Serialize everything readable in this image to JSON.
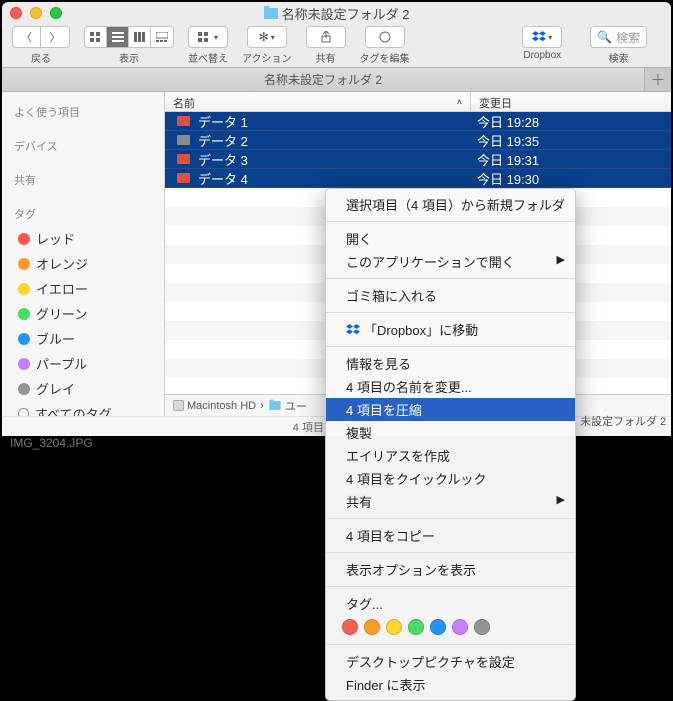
{
  "window": {
    "title": "名称未設定フォルダ 2"
  },
  "toolbar": {
    "back_label": "戻る",
    "view_label": "表示",
    "arrange_label": "並べ替え",
    "action_label": "アクション",
    "share_label": "共有",
    "tags_label": "タグを編集",
    "dropbox_label": "Dropbox",
    "search_label": "検索",
    "search_placeholder": "検索"
  },
  "tabbar": {
    "tab": "名称未設定フォルダ 2",
    "add": "＋"
  },
  "sidebar": {
    "favorites": "よく使う項目",
    "devices": "デバイス",
    "shared": "共有",
    "tags_head": "タグ",
    "tags": [
      {
        "label": "レッド",
        "color": "#ff554a"
      },
      {
        "label": "オレンジ",
        "color": "#ff9a29"
      },
      {
        "label": "イエロー",
        "color": "#ffd42c"
      },
      {
        "label": "グリーン",
        "color": "#4cd964"
      },
      {
        "label": "ブルー",
        "color": "#2094fa"
      },
      {
        "label": "パープル",
        "color": "#c680ff"
      },
      {
        "label": "グレイ",
        "color": "#949494"
      }
    ],
    "all_tags": "すべてのタグ..."
  },
  "columns": {
    "name": "名前",
    "modified": "変更日"
  },
  "rows": [
    {
      "name": "データ 1",
      "date": "今日 19:28",
      "color": "#e24e3f"
    },
    {
      "name": "データ 2",
      "date": "今日 19:35",
      "color": "#8b8b8b"
    },
    {
      "name": "データ 3",
      "date": "今日 19:31",
      "color": "#e24e3f"
    },
    {
      "name": "データ 4",
      "date": "今日 19:30",
      "color": "#e24e3f"
    }
  ],
  "pathbar": {
    "items": [
      "Macintosh HD",
      "ユー"
    ],
    "last": "未設定フォルダ 2",
    "sep": "›"
  },
  "status": "4 項目中の 4 項目",
  "below_file": "IMG_3204.JPG",
  "context_menu": {
    "items": [
      {
        "label": "選択項目（4 項目）から新規フォルダ"
      },
      {
        "sep": true
      },
      {
        "label": "開く"
      },
      {
        "label": "このアプリケーションで開く",
        "submenu": true
      },
      {
        "sep": true
      },
      {
        "label": "ゴミ箱に入れる"
      },
      {
        "sep": true
      },
      {
        "label": "「Dropbox」に移動",
        "dropbox": true
      },
      {
        "sep": true
      },
      {
        "label": "情報を見る"
      },
      {
        "label": "4 項目の名前を変更..."
      },
      {
        "label": "4 項目を圧縮",
        "selected": true
      },
      {
        "label": "複製"
      },
      {
        "label": "エイリアスを作成"
      },
      {
        "label": "4 項目をクイックルック"
      },
      {
        "label": "共有",
        "submenu": true
      },
      {
        "sep": true
      },
      {
        "label": "4 項目をコピー"
      },
      {
        "sep": true
      },
      {
        "label": "表示オプションを表示"
      },
      {
        "sep": true
      },
      {
        "label": "タグ..."
      },
      {
        "tags": true
      },
      {
        "sep": true
      },
      {
        "label": "デスクトップピクチャを設定"
      },
      {
        "label": "Finder に表示"
      }
    ],
    "tag_colors": [
      "#ff5f57",
      "#ff9a29",
      "#ffd42c",
      "#4cd964",
      "#2094fa",
      "#c680ff",
      "#949494"
    ]
  }
}
